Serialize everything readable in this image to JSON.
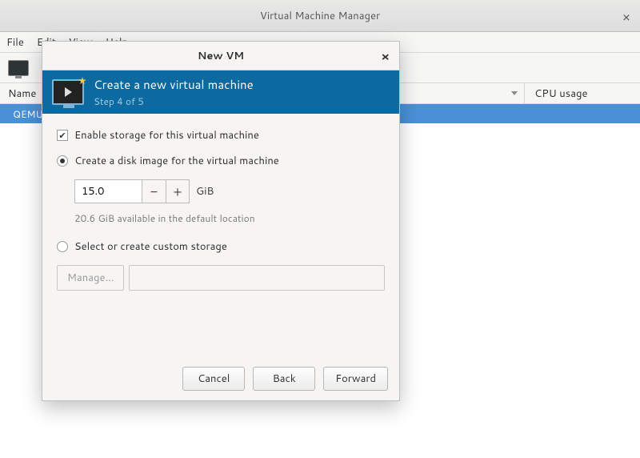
{
  "main_window": {
    "title": "Virtual Machine Manager"
  },
  "menubar": {
    "file": "File",
    "edit": "Edit",
    "view": "View",
    "help": "Help"
  },
  "columns": {
    "name": "Name",
    "cpu": "CPU usage"
  },
  "row": {
    "hypervisor": "QEMU"
  },
  "dialog": {
    "title": "New VM",
    "header_title": "Create a new virtual machine",
    "header_step": "Step 4 of 5",
    "enable_storage_label": "Enable storage for this virtual machine",
    "enable_storage_checked": true,
    "create_disk_label": "Create a disk image for the virtual machine",
    "create_disk_selected": true,
    "disk_size_value": "15.0",
    "disk_size_unit": "GiB",
    "available_text": "20.6 GiB available in the default location",
    "custom_storage_label": "Select or create custom storage",
    "custom_storage_selected": false,
    "manage_label": "Manage...",
    "buttons": {
      "cancel": "Cancel",
      "back": "Back",
      "forward": "Forward"
    }
  }
}
